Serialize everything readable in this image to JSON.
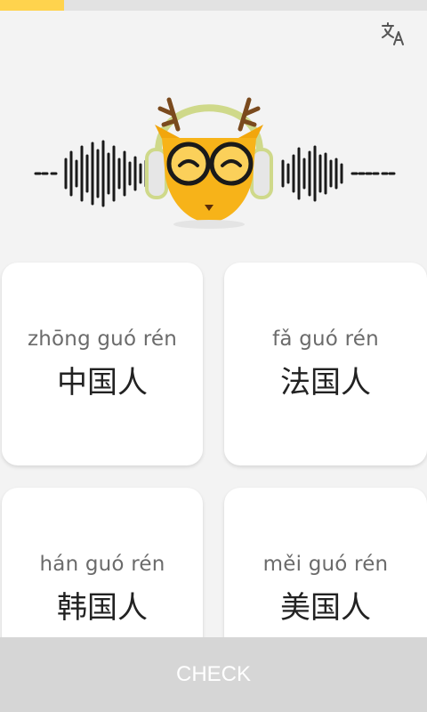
{
  "progress": {
    "fraction": 0.15,
    "color": "#ffd34d",
    "track_color": "#e2e2e2"
  },
  "header": {
    "translate_icon": "translate-icon"
  },
  "audio": {
    "mascot_icon": "deer-headphones-icon",
    "wave_icon": "sound-wave-icon"
  },
  "options": [
    {
      "pinyin": "zhōng guó rén",
      "hanzi": "中国人"
    },
    {
      "pinyin": "fǎ guó rén",
      "hanzi": "法国人"
    },
    {
      "pinyin": "hán guó rén",
      "hanzi": "韩国人"
    },
    {
      "pinyin": "měi guó rén",
      "hanzi": "美国人"
    }
  ],
  "footer": {
    "check_label": "CHECK",
    "bg_color": "#d6d6d6"
  }
}
